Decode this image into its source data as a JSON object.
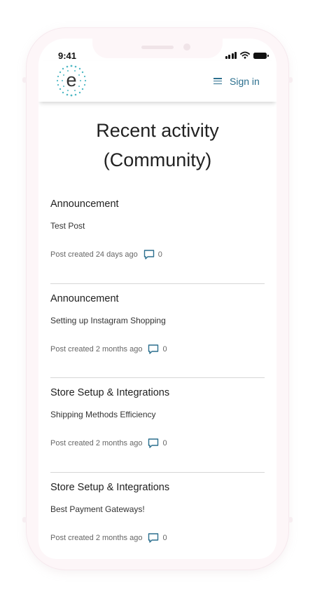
{
  "status_bar": {
    "time": "9:41"
  },
  "header": {
    "sign_in_label": "Sign in",
    "logo_letter": "e"
  },
  "page": {
    "title_line1": "Recent activity",
    "title_line2": "(Community)"
  },
  "posts": [
    {
      "category": "Announcement",
      "title": "Test Post",
      "meta": "Post created 24 days ago",
      "comments": "0"
    },
    {
      "category": "Announcement",
      "title": "Setting up Instagram Shopping",
      "meta": "Post created 2 months ago",
      "comments": "0"
    },
    {
      "category": "Store Setup & Integrations",
      "title": "Shipping Methods Efficiency",
      "meta": "Post created 2 months ago",
      "comments": "0"
    },
    {
      "category": "Store Setup & Integrations",
      "title": "Best Payment Gateways!",
      "meta": "Post created 2 months ago",
      "comments": "0"
    }
  ],
  "colors": {
    "accent": "#2b6f8e",
    "logo_dots": "#4fb8c4",
    "frame": "#fdf6f8"
  },
  "icons": {
    "menu": "hamburger-icon",
    "comment": "comment-icon",
    "signal": "signal-icon",
    "wifi": "wifi-icon",
    "battery": "battery-icon"
  }
}
